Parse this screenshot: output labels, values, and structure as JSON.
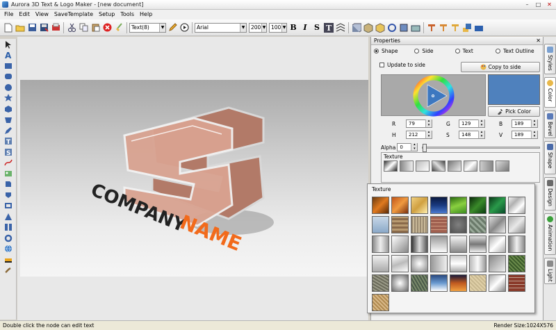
{
  "window": {
    "title": "Aurora 3D Text & Logo Maker - [new document]",
    "min": "–",
    "max": "□",
    "close": "✕"
  },
  "menu": [
    "File",
    "Edit",
    "View",
    "SaveTemplate",
    "Setup",
    "Tools",
    "Help"
  ],
  "toolbar": {
    "text_select": "Text(8)",
    "font_select": "Arial",
    "size1": "200",
    "size2": "100",
    "bold": "B",
    "italic": "I",
    "strike": "S"
  },
  "canvas": {
    "logo_line1": "COMPANY",
    "logo_line2": "NAME",
    "accent": "#f26a1b"
  },
  "properties": {
    "title": "Properties",
    "radios": [
      "Shape",
      "Side",
      "Text",
      "Text Outline"
    ],
    "selected_radio": "Shape",
    "update_label": "Update to side",
    "copy_button": "Copy to side",
    "pick_button": "Pick Color",
    "swatch_color": "#4f81bd",
    "r_label": "R",
    "r_value": "79",
    "g_label": "G",
    "g_value": "129",
    "b_label": "B",
    "b_value": "189",
    "h_label": "H",
    "h_value": "212",
    "s_label": "S",
    "s_value": "148",
    "v_label": "V",
    "v_value": "189",
    "alpha_label": "Alpha",
    "alpha_value": "0",
    "texture_label": "Texture"
  },
  "side_tabs": [
    "Styles",
    "Color",
    "Bevel",
    "Shape",
    "Design",
    "Animation",
    "Light"
  ],
  "texture_popup": {
    "title": "Texture"
  },
  "status": {
    "left": "Double click the node can edit text",
    "right": "Render Size:1024X576"
  }
}
